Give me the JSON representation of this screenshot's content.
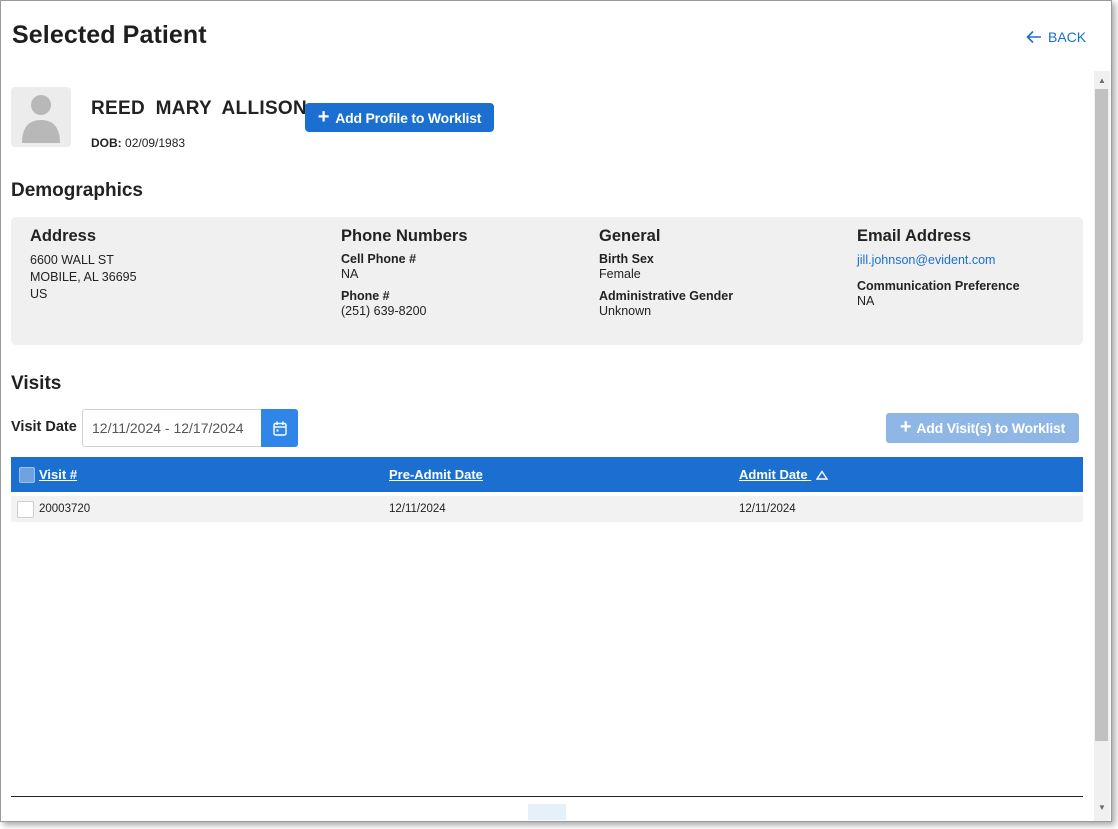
{
  "header": {
    "title": "Selected Patient",
    "back_label": "BACK"
  },
  "patient": {
    "name": "REED  MARY ALLISON",
    "dob_label": "DOB:",
    "dob_value": "02/09/1983",
    "add_profile_label": "Add Profile to Worklist"
  },
  "demographics": {
    "title": "Demographics",
    "address": {
      "heading": "Address",
      "line1": "6600 WALL ST",
      "line2": "MOBILE, AL 36695",
      "line3": "US"
    },
    "phone": {
      "heading": "Phone Numbers",
      "cell_label": "Cell Phone #",
      "cell_value": "NA",
      "phone_label": "Phone #",
      "phone_value": "(251) 639-8200"
    },
    "general": {
      "heading": "General",
      "birth_sex_label": "Birth Sex",
      "birth_sex_value": "Female",
      "admin_gender_label": "Administrative Gender",
      "admin_gender_value": "Unknown"
    },
    "email": {
      "heading": "Email Address",
      "value": "jill.johnson@evident.com",
      "comm_pref_label": "Communication Preference",
      "comm_pref_value": "NA"
    }
  },
  "visits": {
    "title": "Visits",
    "date_label": "Visit Date",
    "date_range": "12/11/2024 - 12/17/2024",
    "add_visits_label": "Add Visit(s) to Worklist",
    "columns": [
      "Visit #",
      "Pre-Admit Date",
      "Admit Date"
    ],
    "rows": [
      {
        "visit": "20003720",
        "pre_admit": "12/11/2024",
        "admit": "12/11/2024"
      }
    ]
  },
  "colors": {
    "accent": "#1a6fd0",
    "button_disabled": "#8fb7e6",
    "card_bg": "#f0f0f0"
  }
}
